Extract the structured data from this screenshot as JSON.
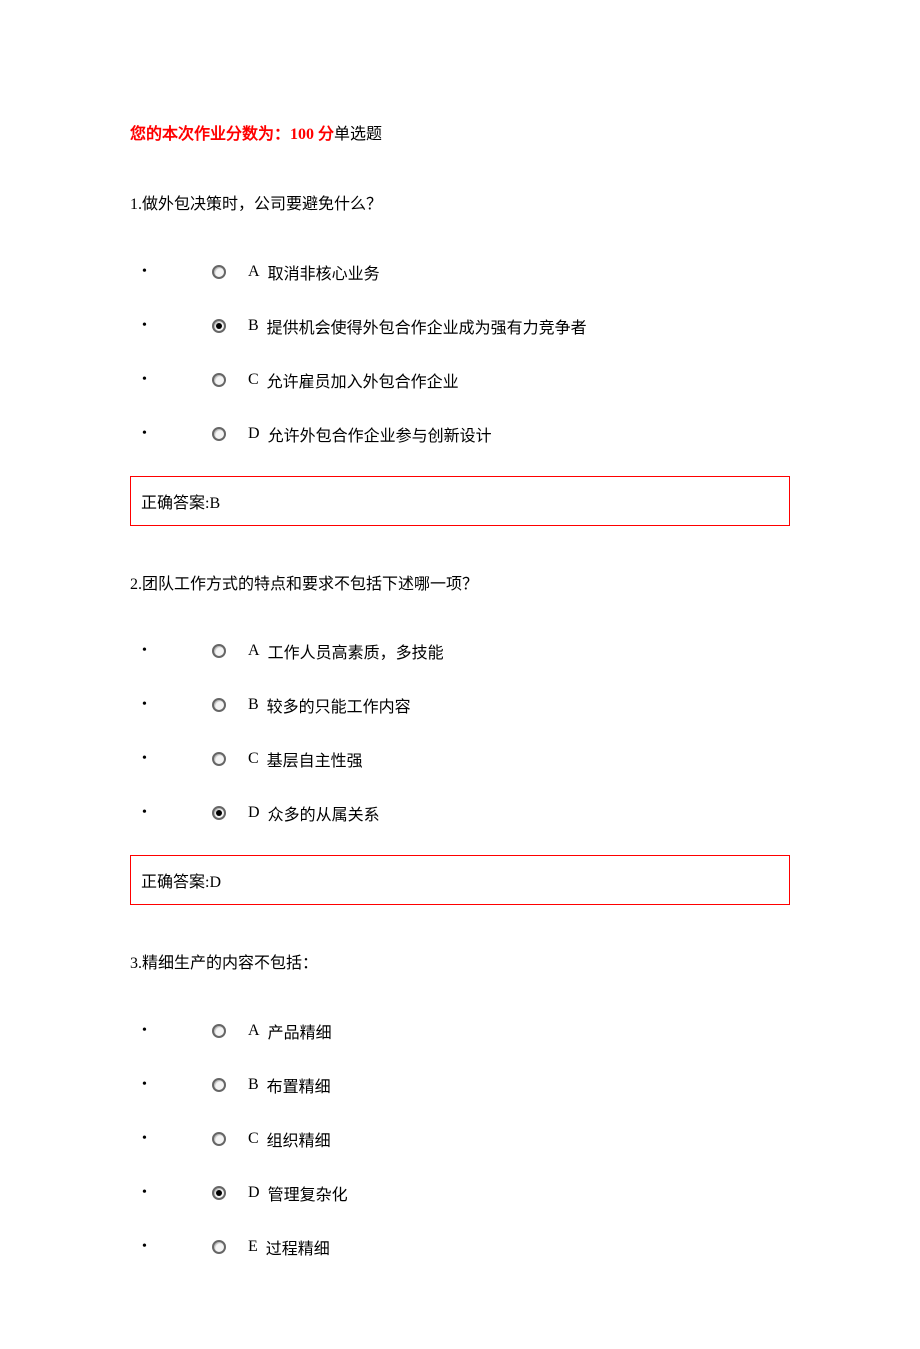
{
  "header": {
    "score_prefix": "您的本次作业分数为：",
    "score_value": "100 分",
    "section_type": "单选题"
  },
  "questions": [
    {
      "number": "1.",
      "text": "做外包决策时，公司要避免什么？",
      "options": [
        {
          "letter": "A",
          "label": "取消非核心业务",
          "selected": false
        },
        {
          "letter": "B",
          "label": "提供机会使得外包合作企业成为强有力竞争者",
          "selected": true
        },
        {
          "letter": "C",
          "label": "允许雇员加入外包合作企业",
          "selected": false
        },
        {
          "letter": "D",
          "label": "允许外包合作企业参与创新设计",
          "selected": false
        }
      ],
      "answer_label": "正确答案:",
      "answer_value": "B"
    },
    {
      "number": "2.",
      "text": "团队工作方式的特点和要求不包括下述哪一项？",
      "options": [
        {
          "letter": "A",
          "label": "工作人员高素质，多技能",
          "selected": false
        },
        {
          "letter": "B",
          "label": "较多的只能工作内容",
          "selected": false
        },
        {
          "letter": "C",
          "label": "基层自主性强",
          "selected": false
        },
        {
          "letter": "D",
          "label": "众多的从属关系",
          "selected": true
        }
      ],
      "answer_label": "正确答案:",
      "answer_value": "D"
    },
    {
      "number": "3.",
      "text": "精细生产的内容不包括：",
      "options": [
        {
          "letter": "A",
          "label": "产品精细",
          "selected": false
        },
        {
          "letter": "B",
          "label": "布置精细",
          "selected": false
        },
        {
          "letter": "C",
          "label": "组织精细",
          "selected": false
        },
        {
          "letter": "D",
          "label": "管理复杂化",
          "selected": true
        },
        {
          "letter": "E",
          "label": "过程精细",
          "selected": false
        }
      ],
      "answer_label": "",
      "answer_value": ""
    }
  ]
}
